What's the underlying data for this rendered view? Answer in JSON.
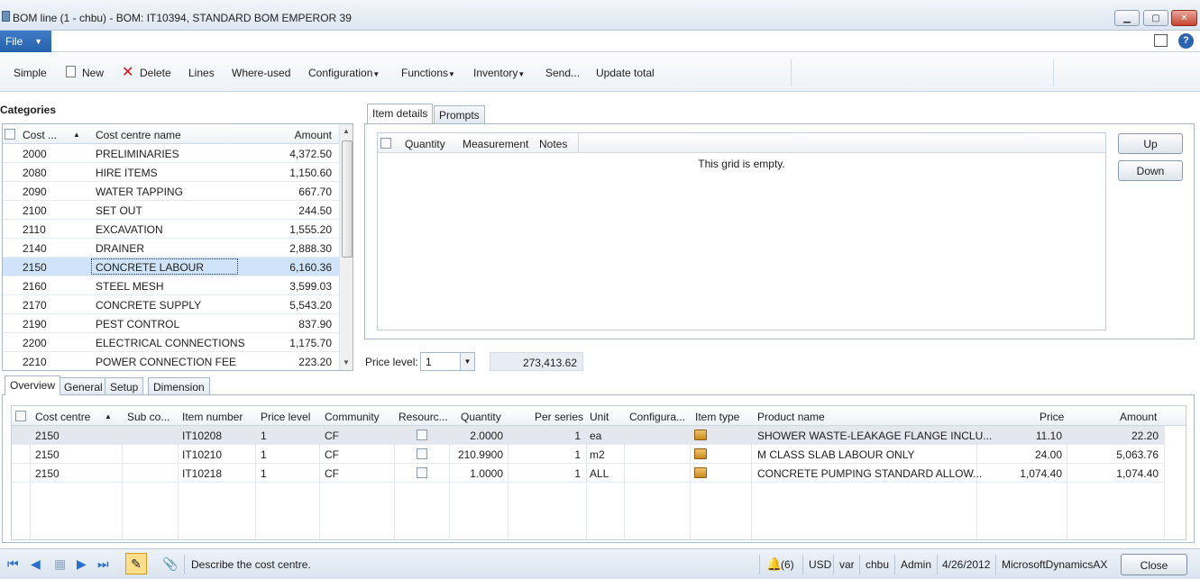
{
  "window": {
    "title": "BOM line (1 - chbu) - BOM: IT10394, STANDARD BOM EMPEROR 39"
  },
  "menu": {
    "file_label": "File"
  },
  "toolbar": {
    "simple": "Simple",
    "new": "New",
    "delete": "Delete",
    "lines": "Lines",
    "where_used": "Where-used",
    "configuration": "Configuration",
    "functions": "Functions",
    "inventory": "Inventory",
    "send": "Send...",
    "update_total": "Update total"
  },
  "categories": {
    "title": "Categories",
    "headers": {
      "cost": "Cost ...",
      "name": "Cost centre name",
      "amount": "Amount"
    },
    "rows": [
      {
        "cost": "2000",
        "name": "PRELIMINARIES",
        "amount": "4,372.50"
      },
      {
        "cost": "2080",
        "name": "HIRE ITEMS",
        "amount": "1,150.60"
      },
      {
        "cost": "2090",
        "name": "WATER TAPPING",
        "amount": "667.70"
      },
      {
        "cost": "2100",
        "name": "SET OUT",
        "amount": "244.50"
      },
      {
        "cost": "2110",
        "name": "EXCAVATION",
        "amount": "1,555.20"
      },
      {
        "cost": "2140",
        "name": "DRAINER",
        "amount": "2,888.30"
      },
      {
        "cost": "2150",
        "name": "CONCRETE LABOUR",
        "amount": "6,160.36"
      },
      {
        "cost": "2160",
        "name": "STEEL MESH",
        "amount": "3,599.03"
      },
      {
        "cost": "2170",
        "name": "CONCRETE SUPPLY",
        "amount": "5,543.20"
      },
      {
        "cost": "2190",
        "name": "PEST CONTROL",
        "amount": "837.90"
      },
      {
        "cost": "2200",
        "name": "ELECTRICAL CONNECTIONS",
        "amount": "1,175.70"
      },
      {
        "cost": "2210",
        "name": "POWER CONNECTION FEE",
        "amount": "223.20"
      }
    ]
  },
  "detail_tabs": {
    "item_details": "Item details",
    "prompts": "Prompts"
  },
  "item_grid": {
    "headers": {
      "quantity": "Quantity",
      "measurement": "Measurement",
      "notes": "Notes"
    },
    "empty_text": "This grid is empty."
  },
  "buttons": {
    "up": "Up",
    "down": "Down",
    "close": "Close"
  },
  "price_level": {
    "label": "Price level:",
    "value": "1",
    "total": "273,413.62"
  },
  "bottom_tabs": {
    "overview": "Overview",
    "general": "General",
    "setup": "Setup",
    "dimension": "Dimension"
  },
  "lines": {
    "headers": {
      "cost_centre": "Cost centre",
      "sub_co": "Sub co...",
      "item_number": "Item number",
      "price_level": "Price level",
      "community": "Community",
      "resource": "Resourc...",
      "quantity": "Quantity",
      "per_series": "Per series",
      "unit": "Unit",
      "configuration": "Configura...",
      "item_type": "Item type",
      "product_name": "Product name",
      "price": "Price",
      "amount": "Amount"
    },
    "rows": [
      {
        "cost_centre": "2150",
        "item_number": "IT10208",
        "price_level": "1",
        "community": "CF",
        "quantity": "2.0000",
        "per_series": "1",
        "unit": "ea",
        "product_name": "SHOWER WASTE-LEAKAGE FLANGE INCLU...",
        "price": "11.10",
        "amount": "22.20"
      },
      {
        "cost_centre": "2150",
        "item_number": "IT10210",
        "price_level": "1",
        "community": "CF",
        "quantity": "210.9900",
        "per_series": "1",
        "unit": "m2",
        "product_name": "M CLASS SLAB LABOUR ONLY",
        "price": "24.00",
        "amount": "5,063.76"
      },
      {
        "cost_centre": "2150",
        "item_number": "IT10218",
        "price_level": "1",
        "community": "CF",
        "quantity": "1.0000",
        "per_series": "1",
        "unit": "ALL",
        "product_name": "CONCRETE PUMPING STANDARD ALLOW...",
        "price": "1,074.40",
        "amount": "1,074.40"
      }
    ]
  },
  "status": {
    "help_text": "Describe the cost centre.",
    "notifications": "(6)",
    "currency": "USD",
    "company": "var",
    "user": "chbu",
    "role": "Admin",
    "date": "4/26/2012",
    "app": "MicrosoftDynamicsAX"
  }
}
